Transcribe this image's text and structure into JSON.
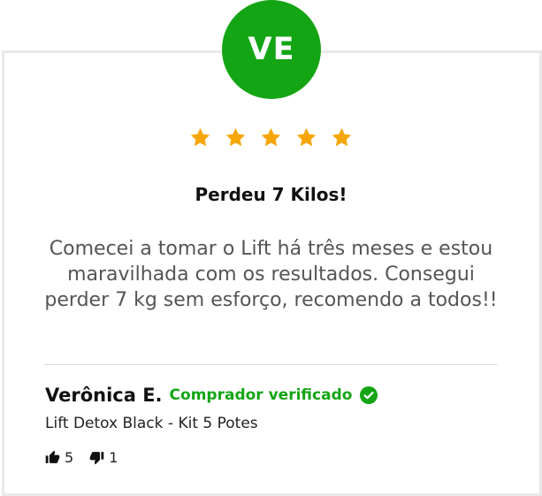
{
  "review": {
    "avatar_initials": "VE",
    "avatar_color": "#14a514",
    "rating": 5,
    "max_rating": 5,
    "star_color": "#f6a609",
    "title": "Perdeu 7 Kilos!",
    "text": "Comecei a tomar o Lift há três meses e estou maravilhada com os resultados. Consegui perder 7 kg sem esforço, recomendo a todos!!",
    "reviewer_name": "Verônica E.",
    "verified_label": "Comprador verificado",
    "verified_color": "#14a514",
    "product": "Lift Detox Black - Kit 5 Potes",
    "helpful_yes": "5",
    "helpful_no": "1",
    "icons": {
      "star": "star-icon",
      "verified": "check-circle-icon",
      "thumbs_up": "thumbs-up-icon",
      "thumbs_down": "thumbs-down-icon"
    }
  }
}
